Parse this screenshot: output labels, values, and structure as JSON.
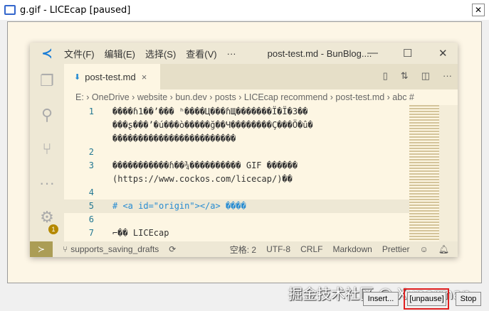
{
  "window": {
    "title": "g.gif - LICEcap [paused]",
    "close": "✕"
  },
  "vscode": {
    "menus": [
      "文件(F)",
      "编辑(E)",
      "选择(S)",
      "查看(V)",
      "···"
    ],
    "title": "post-test.md - BunBlog....",
    "tab": {
      "label": "post-test.md",
      "close": "×"
    },
    "breadcrumb": "E: › OneDrive › website › bun.dev › posts › LICEcap recommend › post-test.md › abc #",
    "settings_badge": "1",
    "lines": [
      {
        "n": "1",
        "text": "����ɦ1��’��� ʰ����Ц���ɦЩ�������Ï�Ï�3��"
      },
      {
        "n": "",
        "text": "���ʂ���’�ú���ò�����ğ��Ч��������Ç���Ö�û�"
      },
      {
        "n": "",
        "text": "������������������������"
      },
      {
        "n": "2",
        "text": ""
      },
      {
        "n": "3",
        "text": "�����������ɦ��¾���������� GIF ������"
      },
      {
        "n": "",
        "text": "(https://www.cockos.com/licecap/)��"
      },
      {
        "n": "4",
        "text": ""
      },
      {
        "n": "5",
        "text": "# <a id=\"origin\"></a> ����"
      },
      {
        "n": "6",
        "text": ""
      },
      {
        "n": "7",
        "text": "⌐�� LICEcap"
      }
    ],
    "status": {
      "branch": "supports_saving_drafts",
      "spaces": "空格: 2",
      "encoding": "UTF-8",
      "eol": "CRLF",
      "language": "Markdown",
      "formatter": "Prettier"
    }
  },
  "buttons": {
    "insert": "Insert...",
    "unpause": "[unpause]",
    "stop": "Stop"
  },
  "watermark": "掘金技术社区 @ Xuperman"
}
